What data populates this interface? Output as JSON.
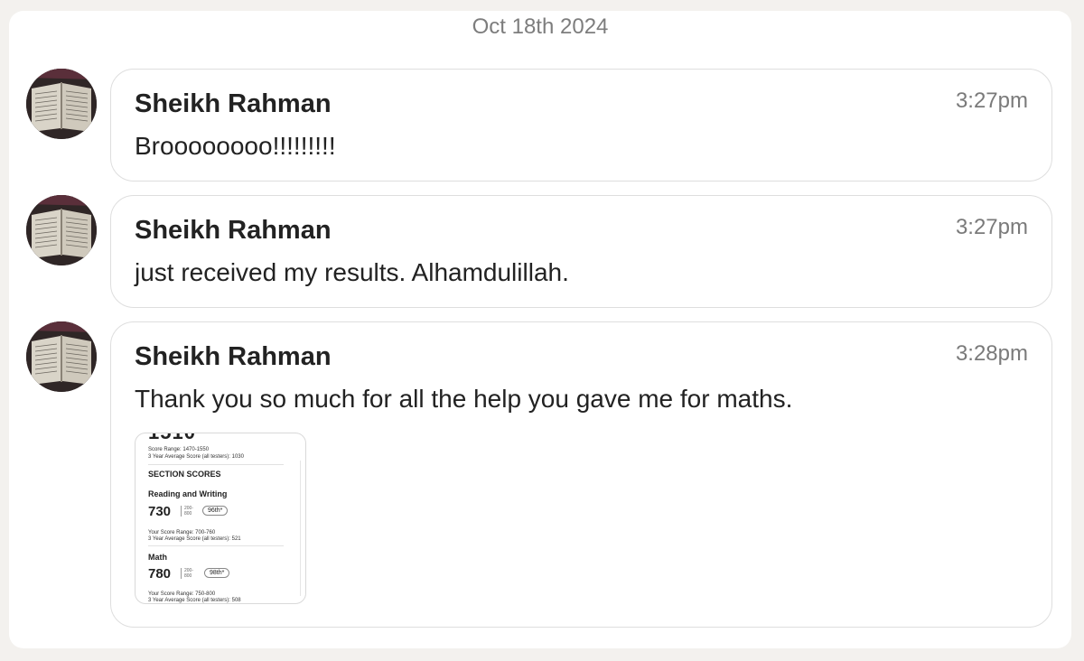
{
  "date_separator": "Oct 18th 2024",
  "messages": [
    {
      "sender": "Sheikh Rahman",
      "time": "3:27pm",
      "text": "Broooooooo!!!!!!!!!"
    },
    {
      "sender": "Sheikh Rahman",
      "time": "3:27pm",
      "text": "just received my results. Alhamdulillah."
    },
    {
      "sender": "Sheikh Rahman",
      "time": "3:28pm",
      "text": "Thank you so much for all the help you gave me for maths.",
      "attachment": {
        "icon": "image-attachment",
        "header_partial": "1510",
        "score_range_line": "Score Range: 1470-1550",
        "avg_line_1": "3 Year Average Score (all testers): 1030",
        "section_title": "SECTION SCORES",
        "reading_title": "Reading and Writing",
        "reading_score": "730",
        "reading_scale": "200-800",
        "reading_percentile": "96th*",
        "reading_range_line": "Your Score Range: 700-760",
        "reading_avg_line": "3 Year Average Score (all testers): 521",
        "math_title": "Math",
        "math_score": "780",
        "math_scale": "200-800",
        "math_percentile": "98th*",
        "math_range_line": "Your Score Range: 750-800",
        "math_avg_line": "3 Year Average Score (all testers): 508"
      }
    }
  ]
}
